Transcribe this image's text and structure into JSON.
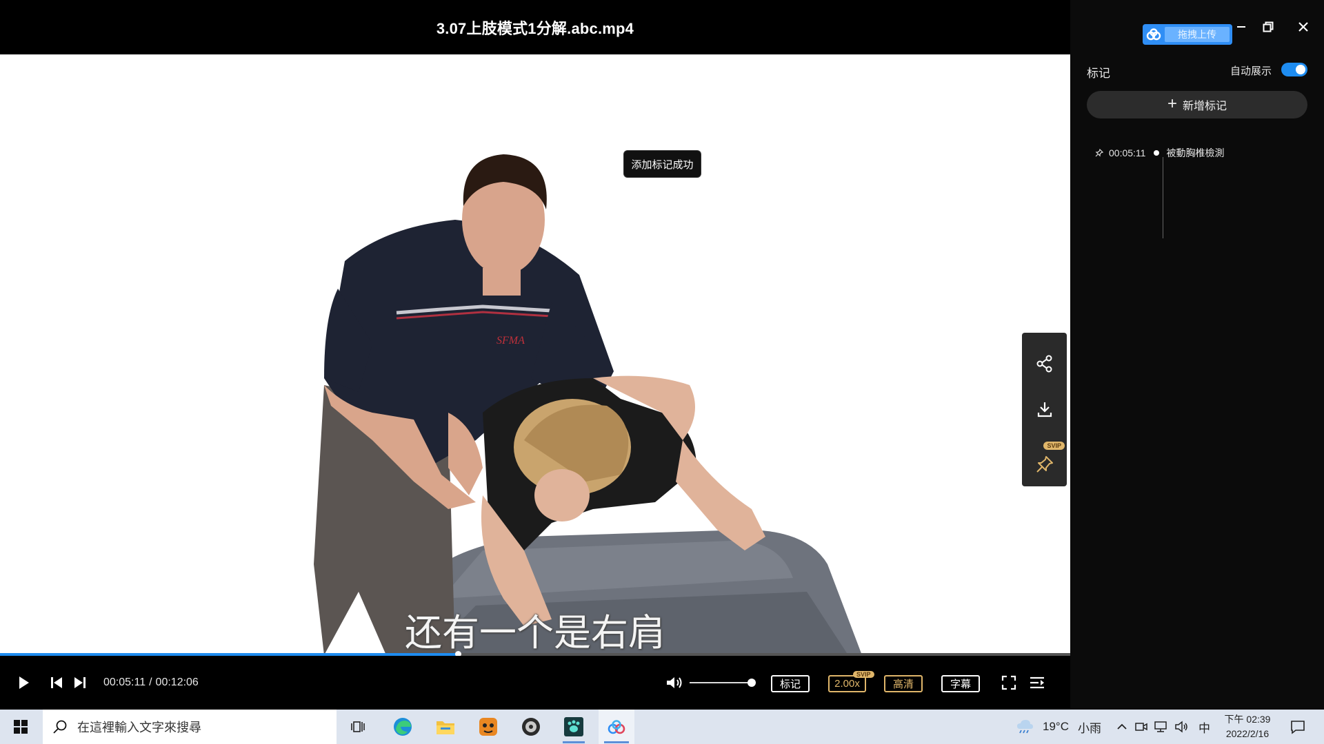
{
  "player": {
    "title": "3.07上肢模式1分解.abc.mp4",
    "toast": "添加标记成功",
    "subtitle": "还有一个是右肩",
    "progress_fraction": 0.428,
    "time_current": "00:05:11",
    "time_separator": "/",
    "time_total": "00:12:06",
    "volume_fraction": 0.95,
    "buttons": {
      "mark": "标记",
      "speed": "2.00x",
      "speed_badge": "SVIP",
      "quality": "高清",
      "subtitle": "字幕"
    },
    "side_tools": [
      "share-icon",
      "download-icon",
      "trash-icon"
    ],
    "pin_badge": "SVIP",
    "shirt_logo": "SFMA"
  },
  "panel": {
    "upload_label": "拖拽上传",
    "heading": "标记",
    "auto_show_label": "自动展示",
    "auto_show_on": true,
    "add_mark_label": "新增标记",
    "marks": [
      {
        "time": "00:05:11",
        "title": "被動胸椎檢測"
      }
    ]
  },
  "taskbar": {
    "search_placeholder": "在這裡輸入文字來搜尋",
    "weather_temp": "19°C",
    "weather_desc": "小雨",
    "ime": "中",
    "clock_time": "下午 02:39",
    "clock_date": "2022/2/16"
  },
  "colors": {
    "accent": "#1e8cf0",
    "svip_gold": "#e0b66a",
    "upload_blue": "#2f8ef5",
    "taskbar_bg": "#dde4ef"
  }
}
